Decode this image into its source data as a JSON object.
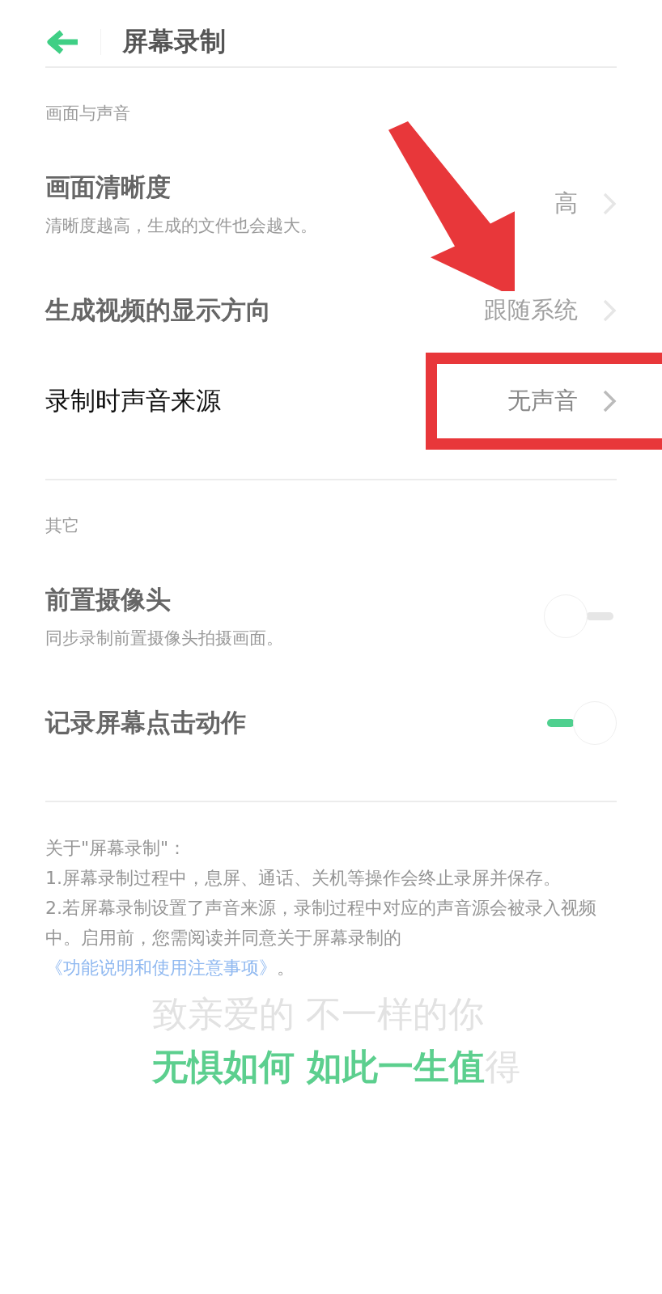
{
  "header": {
    "title": "屏幕录制"
  },
  "sections": [
    {
      "label": "画面与声音",
      "items": [
        {
          "kind": "link",
          "title": "画面清晰度",
          "subtitle": "清晰度越高，生成的文件也会越大。",
          "value": "高",
          "highlighted": false,
          "dim": true
        },
        {
          "kind": "link",
          "title": "生成视频的显示方向",
          "value": "跟随系统",
          "highlighted": false,
          "dim": true
        },
        {
          "kind": "link",
          "title": "录制时声音来源",
          "value": "无声音",
          "highlighted": true,
          "dim": false
        }
      ]
    },
    {
      "label": "其它",
      "items": [
        {
          "kind": "toggle",
          "title": "前置摄像头",
          "subtitle": "同步录制前置摄像头拍摄画面。",
          "on": false,
          "dim": true
        },
        {
          "kind": "toggle",
          "title": "记录屏幕点击动作",
          "on": true,
          "dim": true
        }
      ]
    }
  ],
  "notes": {
    "heading": "关于\"屏幕录制\"：",
    "items": [
      "1.屏幕录制过程中，息屏、通话、关机等操作会终止录屏并保存。",
      "2.若屏幕录制设置了声音来源，录制过程中对应的声音源会被录入视频中。启用前，您需阅读并同意关于屏幕录制的"
    ],
    "link": "《功能说明和使用注意事项》",
    "link_suffix": "。"
  },
  "slogan": {
    "line_1": "致亲爱的 不一样的你",
    "line_2": "无惧如何 如此一生值",
    "line_2_end": "得"
  }
}
